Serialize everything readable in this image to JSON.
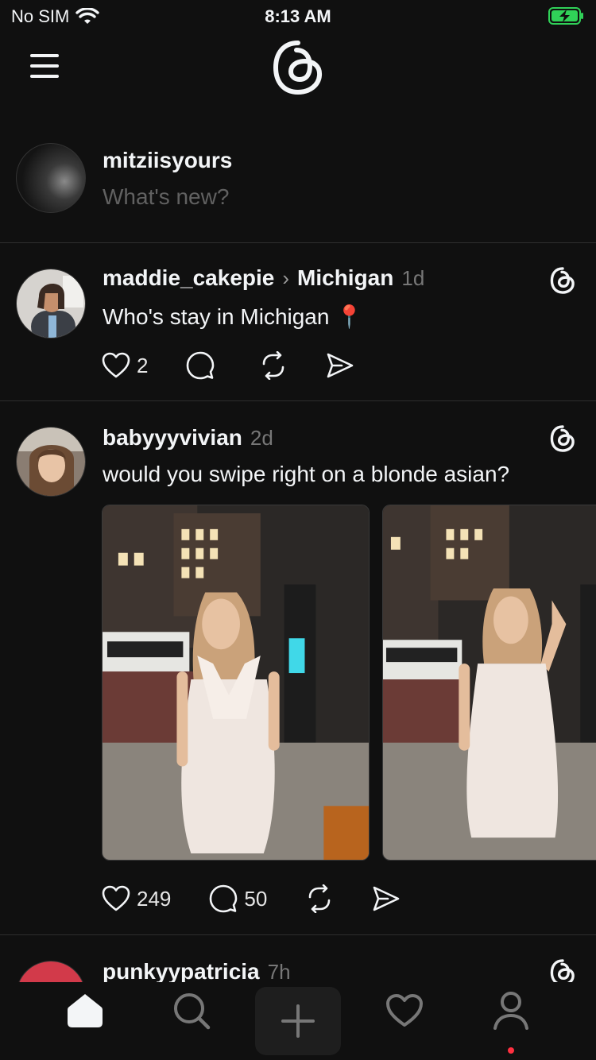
{
  "status_bar": {
    "carrier": "No SIM",
    "time": "8:13 AM"
  },
  "composer": {
    "username": "mitziisyours",
    "prompt": "What's new?"
  },
  "posts": [
    {
      "username": "maddie_cakepie",
      "topic": "Michigan",
      "time": "1d",
      "text": "Who's stay in Michigan 📍",
      "likes": "2",
      "replies": ""
    },
    {
      "username": "babyyyvivian",
      "time": "2d",
      "text": "would you swipe right on a blonde asian?",
      "likes": "249",
      "replies": "50"
    },
    {
      "username": "punkyypatricia",
      "time": "7h"
    }
  ],
  "colors": {
    "background": "#101010",
    "text": "#f3f5f7",
    "muted": "#777777",
    "notification": "#ff3040",
    "battery": "#30d158"
  },
  "icons": [
    "menu-icon",
    "threads-logo-icon",
    "heart-icon",
    "comment-icon",
    "repost-icon",
    "share-icon",
    "home-icon",
    "search-icon",
    "plus-icon",
    "activity-icon",
    "profile-icon"
  ]
}
